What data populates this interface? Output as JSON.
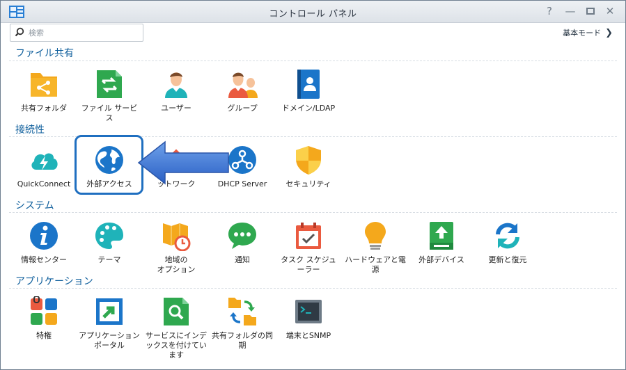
{
  "window": {
    "title": "コントロール パネル",
    "controls": [
      "help-icon",
      "minimize-icon",
      "maximize-icon",
      "close-icon"
    ]
  },
  "search": {
    "placeholder": "検索",
    "value": ""
  },
  "mode_switch": {
    "label": "基本モード"
  },
  "sections": [
    {
      "title": "ファイル共有",
      "items": [
        {
          "label": "共有フォルダ",
          "icon": "shared-folder-icon"
        },
        {
          "label": "ファイル サービ\nス",
          "icon": "file-services-icon"
        },
        {
          "label": "ユーザー",
          "icon": "user-icon"
        },
        {
          "label": "グループ",
          "icon": "group-icon"
        },
        {
          "label": "ドメイン/LDAP",
          "icon": "domain-ldap-icon"
        }
      ]
    },
    {
      "title": "接続性",
      "items": [
        {
          "label": "QuickConnect",
          "icon": "quickconnect-icon"
        },
        {
          "label": "外部アクセス",
          "icon": "external-access-icon"
        },
        {
          "label": "ットワーク",
          "icon": "network-icon"
        },
        {
          "label": "DHCP Server",
          "icon": "dhcp-server-icon"
        },
        {
          "label": "セキュリティ",
          "icon": "security-icon"
        }
      ]
    },
    {
      "title": "システム",
      "items": [
        {
          "label": "情報センター",
          "icon": "info-center-icon"
        },
        {
          "label": "テーマ",
          "icon": "theme-icon"
        },
        {
          "label": "地域の\nオプション",
          "icon": "regional-options-icon"
        },
        {
          "label": "通知",
          "icon": "notification-icon"
        },
        {
          "label": "タスク スケジュ\nーラー",
          "icon": "task-scheduler-icon"
        },
        {
          "label": "ハードウェアと電\n源",
          "icon": "hardware-power-icon"
        },
        {
          "label": "外部デバイス",
          "icon": "external-devices-icon"
        },
        {
          "label": "更新と復元",
          "icon": "update-restore-icon"
        }
      ]
    },
    {
      "title": "アプリケーション",
      "items": [
        {
          "label": "特権",
          "icon": "privileges-icon"
        },
        {
          "label": "アプリケーション\nポータル",
          "icon": "application-portal-icon"
        },
        {
          "label": "サービスにインデ\nックスを付けてい\nます",
          "icon": "indexing-service-icon"
        },
        {
          "label": "共有フォルダの同\n期",
          "icon": "shared-folder-sync-icon"
        },
        {
          "label": "端末とSNMP",
          "icon": "terminal-snmp-icon"
        }
      ]
    }
  ],
  "annotation": {
    "highlighted_item": "外部アクセス",
    "arrow_color": "#2f6fd0"
  }
}
